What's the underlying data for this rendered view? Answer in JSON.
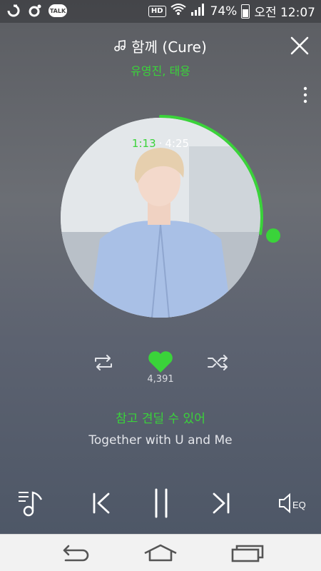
{
  "status_bar": {
    "talk_label": "TALK",
    "hd_label": "HD",
    "battery_text": "74%",
    "time_text": "오전 12:07"
  },
  "header": {
    "song_title": "함께 (Cure)",
    "artist": "유영진, 태용"
  },
  "progress": {
    "current_time": "1:13",
    "separator": "·",
    "total_time": "4:25",
    "fraction": 0.275
  },
  "like": {
    "count": "4,391"
  },
  "lyrics": {
    "current_line": "참고 견딜 수 있어",
    "next_line": "Together with U and Me"
  },
  "player": {
    "eq_label": "EQ"
  },
  "colors": {
    "accent": "#3ad33a",
    "text_light": "#e3e5ea"
  },
  "icons": {
    "song_note": "music-note-icon",
    "close": "close-icon",
    "more": "more-vertical-icon",
    "repeat": "repeat-icon",
    "like": "heart-icon",
    "shuffle": "shuffle-icon",
    "playlist": "playlist-icon",
    "prev": "skip-previous-icon",
    "pause": "pause-icon",
    "next": "skip-next-icon",
    "eq": "equalizer-icon",
    "back": "back-icon",
    "home": "home-icon",
    "recent": "recent-apps-icon"
  }
}
